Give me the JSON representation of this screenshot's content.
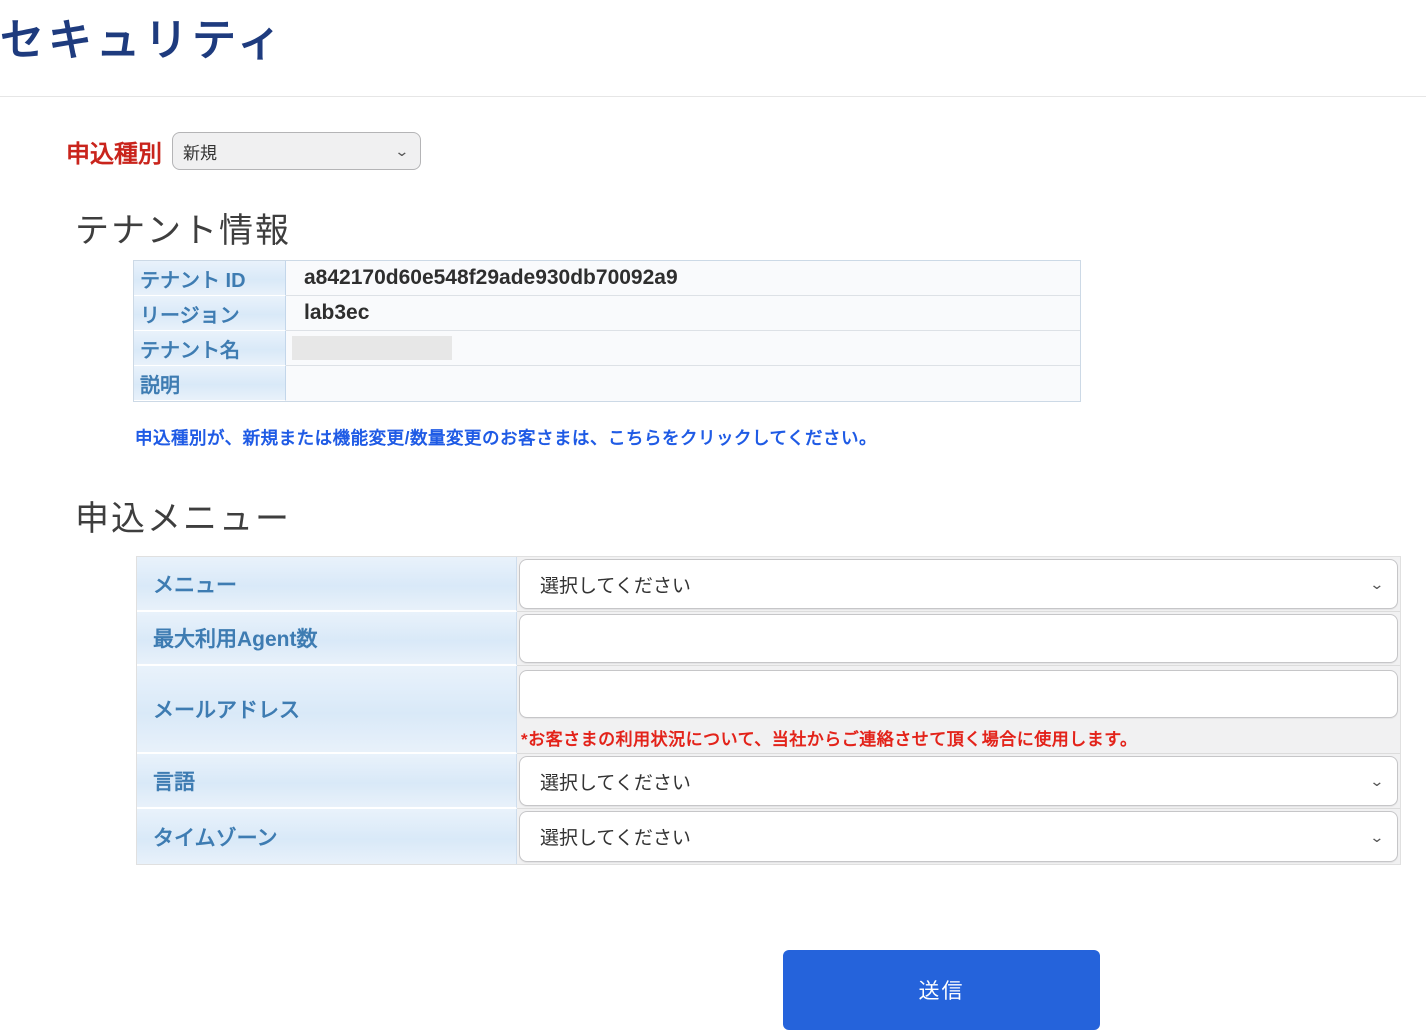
{
  "page": {
    "title": "セキュリティ"
  },
  "application_type": {
    "label": "申込種別",
    "selected": "新規"
  },
  "tenant_info": {
    "heading": "テナント情報",
    "rows": [
      {
        "label": "テナント ID",
        "value": "a842170d60e548f29ade930db70092a9"
      },
      {
        "label": "リージョン",
        "value": "lab3ec"
      },
      {
        "label": "テナント名",
        "value": ""
      },
      {
        "label": "説明",
        "value": ""
      }
    ],
    "notice_link": "申込種別が、新規または機能変更/数量変更のお客さまは、こちらをクリックしてください。"
  },
  "application_menu": {
    "heading": "申込メニュー",
    "fields": [
      {
        "label": "メニュー",
        "type": "select",
        "value": "選択してください"
      },
      {
        "label": "最大利用Agent数",
        "type": "text",
        "value": ""
      },
      {
        "label": "メールアドレス",
        "type": "text",
        "value": "",
        "note": "*お客さまの利用状況について、当社からご連絡させて頂く場合に使用します。"
      },
      {
        "label": "言語",
        "type": "select",
        "value": "選択してください"
      },
      {
        "label": "タイムゾーン",
        "type": "select",
        "value": "選択してください"
      }
    ]
  },
  "submit": {
    "label": "送信"
  },
  "icons": {
    "chevron_down": "⌄"
  },
  "colors": {
    "title": "#1e3b7e",
    "required_label": "#c9241c",
    "table_label_text": "#3e7cb2",
    "link": "#1f5be5",
    "note": "#e3231a",
    "submit_bg": "#2563db",
    "submit_text": "#ffffff"
  }
}
